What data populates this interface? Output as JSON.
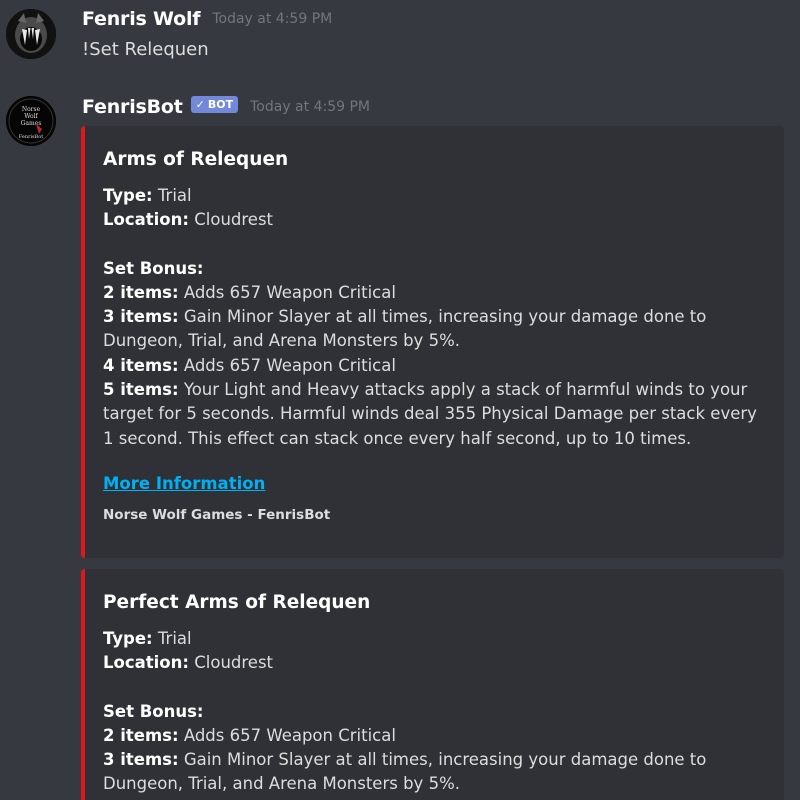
{
  "messages": [
    {
      "author": "Fenris Wolf",
      "timestamp": "Today at 4:59 PM",
      "content": "!Set Relequen"
    },
    {
      "author": "FenrisBot",
      "bot_tag": "BOT",
      "timestamp": "Today at 4:59 PM",
      "avatar_text": [
        "Norse",
        "Wolf",
        "Games",
        "FenrisBot"
      ]
    }
  ],
  "embeds": [
    {
      "title": "Arms of Relequen",
      "type_label": "Type:",
      "type_value": "Trial",
      "location_label": "Location:",
      "location_value": "Cloudrest",
      "set_bonus_label": "Set Bonus:",
      "bonuses": [
        {
          "label": "2 items:",
          "text": "Adds 657 Weapon Critical"
        },
        {
          "label": "3 items:",
          "text": "Gain Minor Slayer at all times, increasing your damage done to Dungeon, Trial, and Arena Monsters by 5%."
        },
        {
          "label": "4 items:",
          "text": "Adds 657 Weapon Critical"
        },
        {
          "label": "5 items:",
          "text": "Your Light and Heavy attacks apply a stack of harmful winds to your target for 5 seconds. Harmful winds deal 355 Physical Damage per stack every 1 second. This effect can stack once every half second, up to 10 times."
        }
      ],
      "link_text": "More Information",
      "footer": "Norse Wolf Games - FenrisBot"
    },
    {
      "title": "Perfect Arms of Relequen",
      "type_label": "Type:",
      "type_value": "Trial",
      "location_label": "Location:",
      "location_value": "Cloudrest",
      "set_bonus_label": "Set Bonus:",
      "bonuses": [
        {
          "label": "2 items:",
          "text": "Adds 657 Weapon Critical"
        },
        {
          "label": "3 items:",
          "text": "Gain Minor Slayer at all times, increasing your damage done to Dungeon, Trial, and Arena Monsters by 5%."
        }
      ]
    }
  ],
  "colors": {
    "background": "#36393f",
    "embed_background": "#2f3136",
    "embed_accent": "#e3171a",
    "link": "#00b0f4",
    "bot_tag": "#7289da",
    "timestamp": "#72767d"
  }
}
